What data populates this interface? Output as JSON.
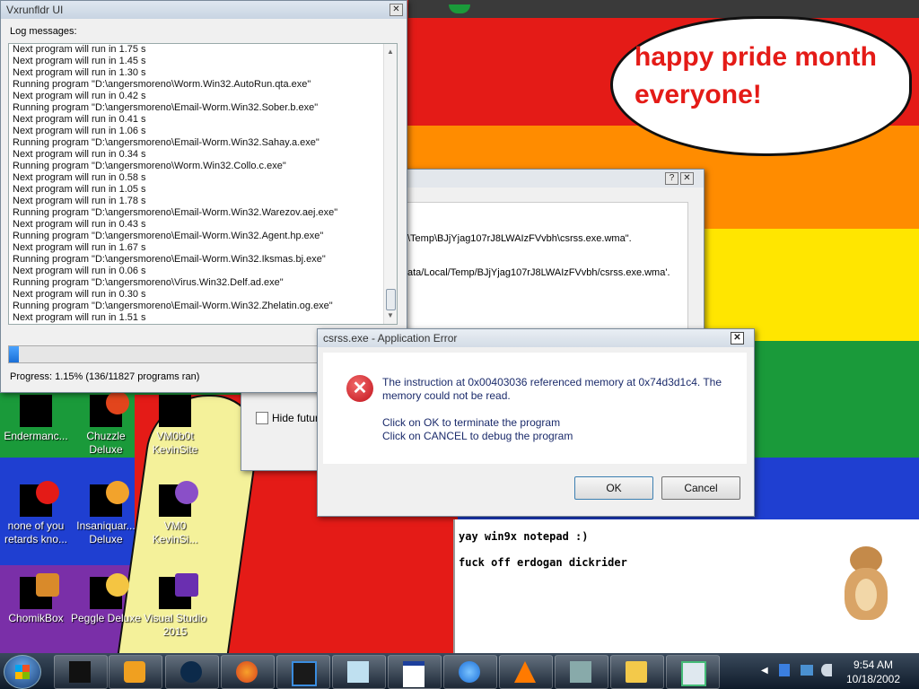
{
  "log_window": {
    "title": "Vxrunfldr UI",
    "log_label": "Log messages:",
    "lines": [
      "Next program will run in 1.75 s",
      "Next program will run in 1.45 s",
      "Next program will run in 1.30 s",
      "Running program \"D:\\angersmoreno\\Worm.Win32.AutoRun.qta.exe\"",
      "Next program will run in 0.42 s",
      "Running program \"D:\\angersmoreno\\Email-Worm.Win32.Sober.b.exe\"",
      "Next program will run in 0.41 s",
      "Next program will run in 1.06 s",
      "Running program \"D:\\angersmoreno\\Email-Worm.Win32.Sahay.a.exe\"",
      "Next program will run in 0.34 s",
      "Running program \"D:\\angersmoreno\\Worm.Win32.Collo.c.exe\"",
      "Next program will run in 0.58 s",
      "Next program will run in 1.05 s",
      "Next program will run in 1.78 s",
      "Running program \"D:\\angersmoreno\\Email-Worm.Win32.Warezov.aej.exe\"",
      "Next program will run in 0.43 s",
      "Running program \"D:\\angersmoreno\\Email-Worm.Win32.Agent.hp.exe\"",
      "Next program will run in 1.67 s",
      "Running program \"D:\\angersmoreno\\Email-Worm.Win32.Iksmas.bj.exe\"",
      "Next program will run in 0.06 s",
      "Running program \"D:\\angersmoreno\\Virus.Win32.Delf.ad.exe\"",
      "Next program will run in 0.30 s",
      "Running program \"D:\\angersmoreno\\Email-Worm.Win32.Zhelatin.og.exe\"",
      "Next program will run in 1.51 s"
    ],
    "progress_fraction": 0.0115,
    "progress_text": "Progress: 1.15% (136/11827 programs ran)"
  },
  "speech_bubble": {
    "line1": "happy pride month",
    "line2": "everyone!"
  },
  "back_dialog": {
    "path_line1": "\\Temp\\BJjYjag107rJ8LWAIzFVvbh\\csrss.exe.wma\".",
    "path_line2": "ata/Local/Temp/BJjYjag107rJ8LWAIzFVvbh/csrss.exe.wma'.",
    "checkbox_label": "Hide futur",
    "help_glyph": "?",
    "close_glyph": "✕"
  },
  "error_dialog": {
    "title": "csrss.exe - Application Error",
    "message1": "The instruction at 0x00403036 referenced memory at 0x74d3d1c4. The",
    "message2": "memory could not be read.",
    "hint1": "Click on OK to terminate the program",
    "hint2": "Click on CANCEL to debug the program",
    "ok_label": "OK",
    "cancel_label": "Cancel",
    "close_glyph": "✕"
  },
  "desktop_icons": [
    {
      "line1": "Endermanc...",
      "line2": ""
    },
    {
      "line1": "Chuzzle",
      "line2": "Deluxe"
    },
    {
      "line1": "VM0b0t",
      "line2": "KevinSite"
    },
    {
      "line1": "none of you",
      "line2": "retards kno..."
    },
    {
      "line1": "Insaniquar...",
      "line2": "Deluxe"
    },
    {
      "line1": "VM0",
      "line2": "KevinSi..."
    },
    {
      "line1": "ChomikBox",
      "line2": ""
    },
    {
      "line1": "Peggle Deluxe",
      "line2": ""
    },
    {
      "line1": "Visual Studio",
      "line2": "2015"
    }
  ],
  "notepad": {
    "line1": "yay win9x notepad :)",
    "line2": "fuck off erdogan dickrider"
  },
  "taskbar": {
    "buttons": [
      "start-orb",
      "black-app",
      "media-player",
      "globe",
      "firefox",
      "phone-app",
      "notepad-app",
      "window-app",
      "internet-explorer",
      "vlc",
      "network-app",
      "folder",
      "control-panel"
    ],
    "time": "9:54 AM",
    "date": "10/18/2002"
  },
  "colors": {
    "red": "#e41b17",
    "orange": "#ff8c00",
    "yellow": "#ffe600",
    "green": "#1a9a3a",
    "blue": "#1f3fd1",
    "purple": "#7a2fa8",
    "bubble_text": "#e41b17",
    "error_icon": "#d9262c"
  }
}
